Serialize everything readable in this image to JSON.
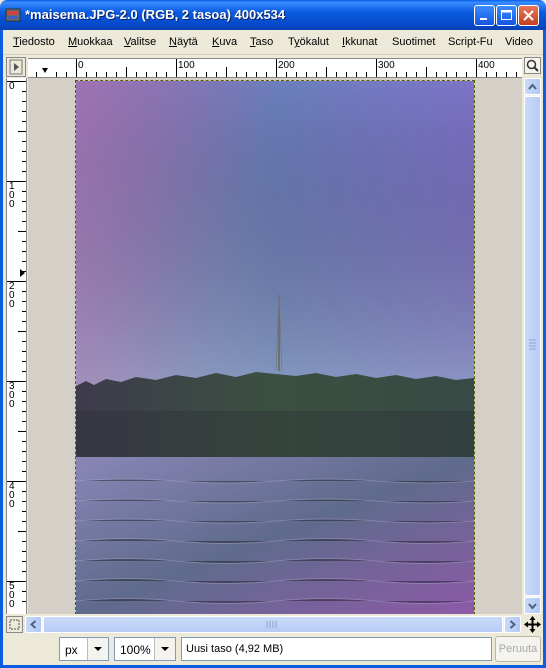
{
  "window": {
    "title": "*maisema.JPG-2.0 (RGB, 2 tasoa) 400x534"
  },
  "menu": [
    {
      "label": "Tiedosto",
      "mnemonic": "T",
      "rest": "iedosto"
    },
    {
      "label": "Muokkaa",
      "mnemonic": "M",
      "rest": "uokkaa"
    },
    {
      "label": "Valitse",
      "mnemonic": "V",
      "rest": "alitse"
    },
    {
      "label": "Näytä",
      "mnemonic": "N",
      "rest": "äytä"
    },
    {
      "label": "Kuva",
      "mnemonic": "K",
      "rest": "uva"
    },
    {
      "label": "Taso",
      "mnemonic": "T",
      "rest": "aso"
    },
    {
      "label": "Työkalut",
      "mnemonic": "y",
      "pre": "T",
      "rest": "ökalut"
    },
    {
      "label": "Ikkunat",
      "mnemonic": "I",
      "rest": "kkunat"
    },
    {
      "label": "Suotimet",
      "mnemonic": "",
      "rest": "Suotimet"
    },
    {
      "label": "Script-Fu",
      "mnemonic": "",
      "rest": "Script-Fu"
    },
    {
      "label": "Video",
      "mnemonic": "",
      "rest": "Video"
    }
  ],
  "rulers": {
    "horizontal_labels": [
      "0",
      "100",
      "200",
      "300",
      "400"
    ],
    "vertical_labels": [
      "0",
      "100",
      "200",
      "300",
      "400",
      "500"
    ]
  },
  "statusbar": {
    "unit": "px",
    "zoom": "100%",
    "message": "Uusi taso (4,92 MB)",
    "cancel_label": "Peruuta"
  },
  "colors": {
    "titlebar": "#0b5ce0",
    "chrome": "#ece9d8",
    "scrollbar": "#c9daf9"
  }
}
